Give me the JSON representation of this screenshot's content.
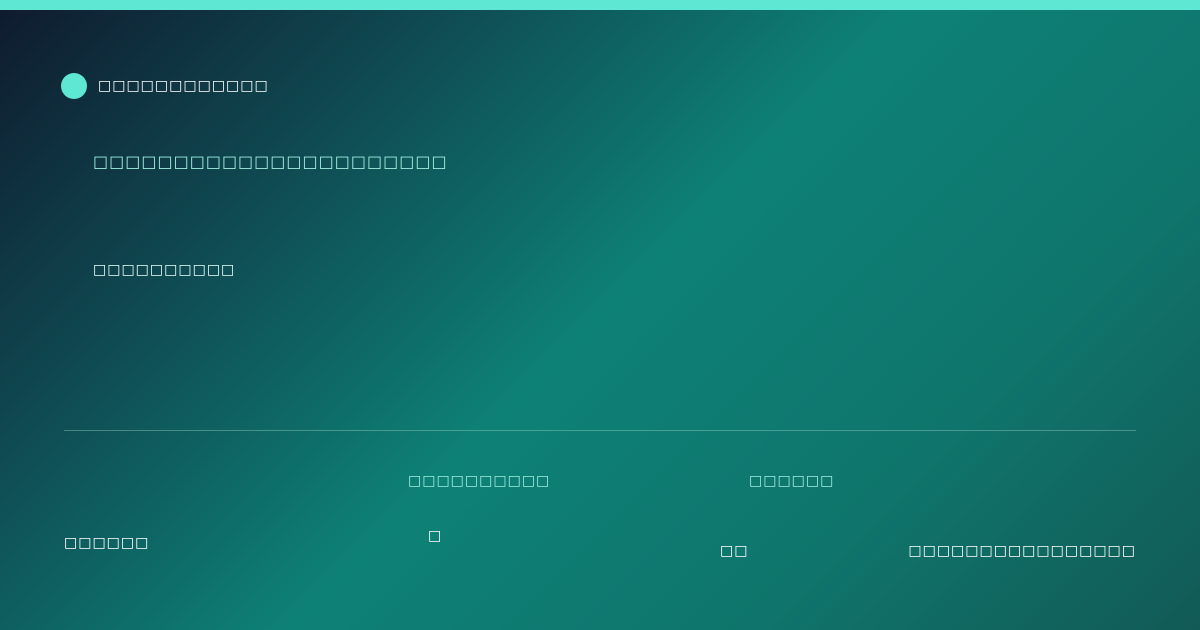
{
  "theme": {
    "accent": "#5ee7d2",
    "gradient": [
      "#0f1a2e",
      "#0f4b52",
      "#0e8176",
      "#125a56"
    ]
  },
  "header": {
    "brand_icon": "circle-logo-icon",
    "brand_name": "□□□□□□□□□□□□"
  },
  "main": {
    "headline": "□□□□□□□□□□□□□□□□□□□□□□",
    "subline": "□□□□□□□□□□"
  },
  "footer": {
    "left_text": "□□□□□□",
    "stats": [
      {
        "label": "□□□□□□□□□□",
        "value": "□"
      },
      {
        "label": "□□□□□□",
        "value": "□□"
      }
    ],
    "right_text": "□□□□□□□□□□□□□□□□"
  }
}
